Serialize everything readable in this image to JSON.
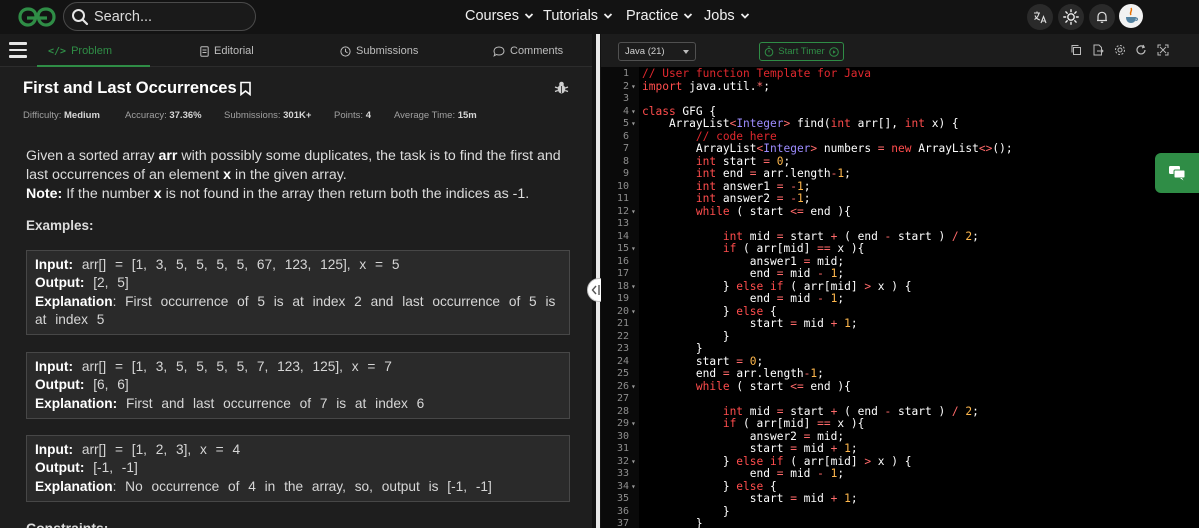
{
  "nav": {
    "search_placeholder": "Search...",
    "menus": [
      "Courses",
      "Tutorials",
      "Practice",
      "Jobs"
    ]
  },
  "tabs": [
    {
      "label": "Problem",
      "active": true
    },
    {
      "label": "Editorial",
      "active": false
    },
    {
      "label": "Submissions",
      "active": false
    },
    {
      "label": "Comments",
      "active": false
    }
  ],
  "problem": {
    "title": "First and Last Occurrences",
    "meta": [
      {
        "label": "Difficulty:",
        "value": "Medium"
      },
      {
        "label": "Accuracy:",
        "value": "37.36%"
      },
      {
        "label": "Submissions:",
        "value": "301K+"
      },
      {
        "label": "Points:",
        "value": "4"
      },
      {
        "label": "Average Time:",
        "value": "15m"
      }
    ],
    "desc_p1": "Given a sorted array",
    "desc_arr": "arr",
    "desc_p2": "with possibly some duplicates, the task is to find the first and last occurrences of an element",
    "desc_x": "x",
    "desc_p3": "in the given array.",
    "note_label": "Note:",
    "note_p1": "If the number",
    "note_x": "x",
    "note_p2": "is not found in the array then return both the indices as -1.",
    "examples_heading": "Examples:",
    "constraints_heading": "Constraints:",
    "examples": [
      {
        "input_label": "Input:",
        "input": "arr[] = [1, 3, 5, 5, 5, 5, 67, 123, 125], x = 5",
        "output_label": "Output:",
        "output": "[2, 5]",
        "explanation_label": "Explanation",
        "explanation": ": First occurrence of 5 is at index 2 and last occurrence of 5 is at index 5"
      },
      {
        "input_label": "Input:",
        "input": "arr[] = [1, 3, 5, 5, 5, 5, 7, 123, 125], x = 7",
        "output_label": "Output:",
        "output": "[6, 6]",
        "explanation_label": "Explanation:",
        "explanation": "First and last occurrence of 7 is at index 6"
      },
      {
        "input_label": "Input:",
        "input": "arr[] = [1, 2, 3], x = 4",
        "output_label": "Output:",
        "output": "[-1, -1]",
        "explanation_label": "Explanation",
        "explanation": ": No occurrence of 4 in the array, so, output is [-1, -1]"
      }
    ]
  },
  "editor": {
    "language": "Java (21)",
    "timer_label": "Start Timer",
    "fold_lines": [
      2,
      4,
      5,
      12,
      15,
      18,
      20,
      26,
      29,
      32,
      34
    ],
    "lines": [
      [
        [
          "c",
          "// User function Template for Java"
        ]
      ],
      [
        [
          "k",
          "import"
        ],
        [
          "t",
          " java.util."
        ],
        [
          "o",
          "*"
        ],
        [
          "t",
          ";"
        ]
      ],
      [],
      [
        [
          "k",
          "class"
        ],
        [
          "t",
          " GFG {"
        ]
      ],
      [
        [
          "t",
          "    ArrayList"
        ],
        [
          "o",
          "<"
        ],
        [
          "y",
          "Integer"
        ],
        [
          "o",
          ">"
        ],
        [
          "t",
          " find("
        ],
        [
          "k",
          "int"
        ],
        [
          "t",
          " arr[], "
        ],
        [
          "k",
          "int"
        ],
        [
          "t",
          " x) {"
        ]
      ],
      [
        [
          "c",
          "        // code here"
        ]
      ],
      [
        [
          "t",
          "        ArrayList"
        ],
        [
          "o",
          "<"
        ],
        [
          "y",
          "Integer"
        ],
        [
          "o",
          ">"
        ],
        [
          "t",
          " numbers "
        ],
        [
          "o",
          "="
        ],
        [
          "t",
          " "
        ],
        [
          "k",
          "new"
        ],
        [
          "t",
          " ArrayList"
        ],
        [
          "o",
          "<>"
        ],
        [
          "t",
          "();"
        ]
      ],
      [
        [
          "t",
          "        "
        ],
        [
          "k",
          "int"
        ],
        [
          "t",
          " start "
        ],
        [
          "o",
          "="
        ],
        [
          "t",
          " "
        ],
        [
          "n",
          "0"
        ],
        [
          "t",
          ";"
        ]
      ],
      [
        [
          "t",
          "        "
        ],
        [
          "k",
          "int"
        ],
        [
          "t",
          " end "
        ],
        [
          "o",
          "="
        ],
        [
          "t",
          " arr.length"
        ],
        [
          "o",
          "-"
        ],
        [
          "n",
          "1"
        ],
        [
          "t",
          ";"
        ]
      ],
      [
        [
          "t",
          "        "
        ],
        [
          "k",
          "int"
        ],
        [
          "t",
          " answer1 "
        ],
        [
          "o",
          "="
        ],
        [
          "t",
          " "
        ],
        [
          "o",
          "-"
        ],
        [
          "n",
          "1"
        ],
        [
          "t",
          ";"
        ]
      ],
      [
        [
          "t",
          "        "
        ],
        [
          "k",
          "int"
        ],
        [
          "t",
          " answer2 "
        ],
        [
          "o",
          "="
        ],
        [
          "t",
          " "
        ],
        [
          "o",
          "-"
        ],
        [
          "n",
          "1"
        ],
        [
          "t",
          ";"
        ]
      ],
      [
        [
          "t",
          "        "
        ],
        [
          "k",
          "while"
        ],
        [
          "t",
          " ( start "
        ],
        [
          "o",
          "<="
        ],
        [
          "t",
          " end ){"
        ]
      ],
      [],
      [
        [
          "t",
          "            "
        ],
        [
          "k",
          "int"
        ],
        [
          "t",
          " mid "
        ],
        [
          "o",
          "="
        ],
        [
          "t",
          " start "
        ],
        [
          "o",
          "+"
        ],
        [
          "t",
          " ( end "
        ],
        [
          "o",
          "-"
        ],
        [
          "t",
          " start ) "
        ],
        [
          "o",
          "/"
        ],
        [
          "t",
          " "
        ],
        [
          "n",
          "2"
        ],
        [
          "t",
          ";"
        ]
      ],
      [
        [
          "t",
          "            "
        ],
        [
          "k",
          "if"
        ],
        [
          "t",
          " ( arr[mid] "
        ],
        [
          "o",
          "=="
        ],
        [
          "t",
          " x ){"
        ]
      ],
      [
        [
          "t",
          "                answer1 "
        ],
        [
          "o",
          "="
        ],
        [
          "t",
          " mid;"
        ]
      ],
      [
        [
          "t",
          "                end "
        ],
        [
          "o",
          "="
        ],
        [
          "t",
          " mid "
        ],
        [
          "o",
          "-"
        ],
        [
          "t",
          " "
        ],
        [
          "n",
          "1"
        ],
        [
          "t",
          ";"
        ]
      ],
      [
        [
          "t",
          "            } "
        ],
        [
          "k",
          "else"
        ],
        [
          "t",
          " "
        ],
        [
          "k",
          "if"
        ],
        [
          "t",
          " ( arr[mid] "
        ],
        [
          "o",
          ">"
        ],
        [
          "t",
          " x ) {"
        ]
      ],
      [
        [
          "t",
          "                end "
        ],
        [
          "o",
          "="
        ],
        [
          "t",
          " mid "
        ],
        [
          "o",
          "-"
        ],
        [
          "t",
          " "
        ],
        [
          "n",
          "1"
        ],
        [
          "t",
          ";"
        ]
      ],
      [
        [
          "t",
          "            } "
        ],
        [
          "k",
          "else"
        ],
        [
          "t",
          " {"
        ]
      ],
      [
        [
          "t",
          "                start "
        ],
        [
          "o",
          "="
        ],
        [
          "t",
          " mid "
        ],
        [
          "o",
          "+"
        ],
        [
          "t",
          " "
        ],
        [
          "n",
          "1"
        ],
        [
          "t",
          ";"
        ]
      ],
      [
        [
          "t",
          "            }"
        ]
      ],
      [
        [
          "t",
          "        }"
        ]
      ],
      [
        [
          "t",
          "        start "
        ],
        [
          "o",
          "="
        ],
        [
          "t",
          " "
        ],
        [
          "n",
          "0"
        ],
        [
          "t",
          ";"
        ]
      ],
      [
        [
          "t",
          "        end "
        ],
        [
          "o",
          "="
        ],
        [
          "t",
          " arr.length"
        ],
        [
          "o",
          "-"
        ],
        [
          "n",
          "1"
        ],
        [
          "t",
          ";"
        ]
      ],
      [
        [
          "t",
          "        "
        ],
        [
          "k",
          "while"
        ],
        [
          "t",
          " ( start "
        ],
        [
          "o",
          "<="
        ],
        [
          "t",
          " end ){"
        ]
      ],
      [],
      [
        [
          "t",
          "            "
        ],
        [
          "k",
          "int"
        ],
        [
          "t",
          " mid "
        ],
        [
          "o",
          "="
        ],
        [
          "t",
          " start "
        ],
        [
          "o",
          "+"
        ],
        [
          "t",
          " ( end "
        ],
        [
          "o",
          "-"
        ],
        [
          "t",
          " start ) "
        ],
        [
          "o",
          "/"
        ],
        [
          "t",
          " "
        ],
        [
          "n",
          "2"
        ],
        [
          "t",
          ";"
        ]
      ],
      [
        [
          "t",
          "            "
        ],
        [
          "k",
          "if"
        ],
        [
          "t",
          " ( arr[mid] "
        ],
        [
          "o",
          "=="
        ],
        [
          "t",
          " x ){"
        ]
      ],
      [
        [
          "t",
          "                answer2 "
        ],
        [
          "o",
          "="
        ],
        [
          "t",
          " mid;"
        ]
      ],
      [
        [
          "t",
          "                start "
        ],
        [
          "o",
          "="
        ],
        [
          "t",
          " mid "
        ],
        [
          "o",
          "+"
        ],
        [
          "t",
          " "
        ],
        [
          "n",
          "1"
        ],
        [
          "t",
          ";"
        ]
      ],
      [
        [
          "t",
          "            } "
        ],
        [
          "k",
          "else"
        ],
        [
          "t",
          " "
        ],
        [
          "k",
          "if"
        ],
        [
          "t",
          " ( arr[mid] "
        ],
        [
          "o",
          ">"
        ],
        [
          "t",
          " x ) {"
        ]
      ],
      [
        [
          "t",
          "                end "
        ],
        [
          "o",
          "="
        ],
        [
          "t",
          " mid "
        ],
        [
          "o",
          "-"
        ],
        [
          "t",
          " "
        ],
        [
          "n",
          "1"
        ],
        [
          "t",
          ";"
        ]
      ],
      [
        [
          "t",
          "            } "
        ],
        [
          "k",
          "else"
        ],
        [
          "t",
          " {"
        ]
      ],
      [
        [
          "t",
          "                start "
        ],
        [
          "o",
          "="
        ],
        [
          "t",
          " mid "
        ],
        [
          "o",
          "+"
        ],
        [
          "t",
          " "
        ],
        [
          "n",
          "1"
        ],
        [
          "t",
          ";"
        ]
      ],
      [
        [
          "t",
          "            }"
        ]
      ],
      [
        [
          "t",
          "        }"
        ]
      ]
    ]
  },
  "colors": {
    "accent_green": "#2f8d46",
    "keyword": "#ff4d4d",
    "comment": "#e0282e",
    "operator": "#ff6a6a",
    "number": "#ffb84d",
    "type": "#9d8cff",
    "text": "#ffffff"
  }
}
